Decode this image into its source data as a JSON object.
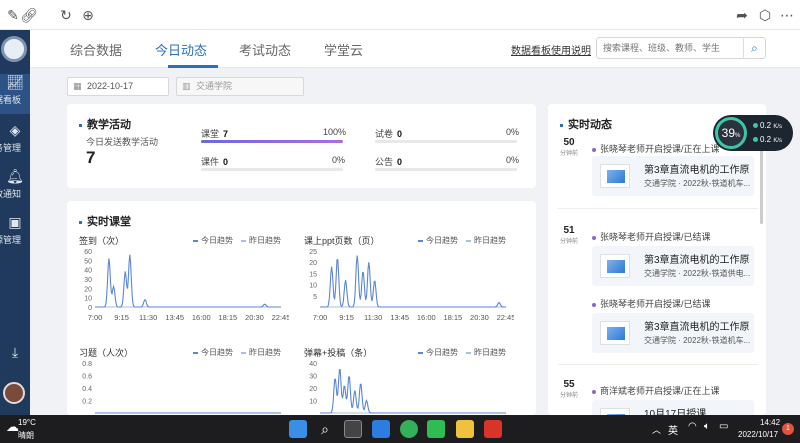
{
  "browser": {
    "icons": [
      "pen-icon",
      "link-icon",
      "refresh-icon",
      "globe-icon",
      "share-icon",
      "cube-icon",
      "more-icon"
    ]
  },
  "sidebar": {
    "items": [
      {
        "label": "据看板",
        "icon": "chart-icon",
        "active": true
      },
      {
        "label": "务管理",
        "icon": "layers-icon",
        "active": false
      },
      {
        "label": "政通知",
        "icon": "bell-icon",
        "active": false
      },
      {
        "label": "源管理",
        "icon": "box-icon",
        "active": false
      }
    ]
  },
  "nav": {
    "tabs": [
      {
        "label": "综合数据",
        "active": false
      },
      {
        "label": "今日动态",
        "active": true
      },
      {
        "label": "考试动态",
        "active": false
      },
      {
        "label": "学堂云",
        "active": false
      }
    ],
    "help_link": "数据看板使用说明",
    "search_placeholder": "搜索课程、班级、教师、学生"
  },
  "filters": {
    "date": "2022-10-17",
    "college": "交通学院"
  },
  "teaching": {
    "title": "教学活动",
    "today_label": "今日发送教学活动",
    "today_count": "7",
    "metrics": [
      {
        "label": "课堂",
        "value": "7",
        "percent": "100%",
        "fill": 1.0
      },
      {
        "label": "课件",
        "value": "0",
        "percent": "0%",
        "fill": 0
      },
      {
        "label": "试卷",
        "value": "0",
        "percent": "0%",
        "fill": 0
      },
      {
        "label": "公告",
        "value": "0",
        "percent": "0%",
        "fill": 0
      }
    ]
  },
  "realtime_class": {
    "title": "实时课堂",
    "legend_today": "今日趋势",
    "legend_yesterday": "昨日趋势"
  },
  "chart_data": [
    {
      "type": "line",
      "title": "签到（次）",
      "x": [
        "7:00",
        "9:15",
        "11:30",
        "13:45",
        "16:00",
        "18:15",
        "20:30",
        "22:45"
      ],
      "ylim": [
        0,
        60
      ],
      "yticks": [
        0,
        10,
        20,
        30,
        40,
        50,
        60
      ],
      "series": [
        {
          "name": "今日趋势",
          "peaks": [
            [
              8.2,
              52
            ],
            [
              8.6,
              22
            ],
            [
              9.6,
              38
            ],
            [
              10.0,
              56
            ],
            [
              11.3,
              8
            ],
            [
              21.6,
              3
            ]
          ]
        },
        {
          "name": "昨日趋势",
          "flat": 0
        }
      ]
    },
    {
      "type": "line",
      "title": "课上ppt页数（页）",
      "x": [
        "7:00",
        "9:15",
        "11:30",
        "13:45",
        "16:00",
        "18:15",
        "20:30",
        "22:45"
      ],
      "ylim": [
        0,
        25
      ],
      "yticks": [
        5,
        10,
        15,
        20,
        25
      ],
      "series": [
        {
          "name": "今日趋势",
          "peaks": [
            [
              8.0,
              18
            ],
            [
              8.5,
              22
            ],
            [
              9.2,
              12
            ],
            [
              10.2,
              23
            ],
            [
              10.7,
              16
            ],
            [
              11.2,
              20
            ],
            [
              11.7,
              12
            ],
            [
              22.4,
              2
            ]
          ]
        },
        {
          "name": "昨日趋势",
          "flat": 0
        }
      ]
    },
    {
      "type": "line",
      "title": "习题（人次）",
      "x": [
        "7:00",
        "9:15",
        "11:30",
        "13:45",
        "16:00",
        "18:15",
        "20:30",
        "22:45"
      ],
      "ylim": [
        0,
        0.8
      ],
      "yticks": [
        0.2,
        0.4,
        0.6,
        0.8
      ],
      "series": [
        {
          "name": "今日趋势",
          "flat": 0
        },
        {
          "name": "昨日趋势",
          "flat": 0
        }
      ]
    },
    {
      "type": "line",
      "title": "弹幕+投稿（条）",
      "x": [
        "7:00",
        "9:15",
        "11:30",
        "13:45",
        "16:00",
        "18:15",
        "20:30",
        "22:45"
      ],
      "ylim": [
        0,
        40
      ],
      "yticks": [
        10,
        20,
        30,
        40
      ],
      "series": [
        {
          "name": "今日趋势",
          "peaks": [
            [
              8.3,
              28
            ],
            [
              8.7,
              36
            ],
            [
              9.1,
              22
            ],
            [
              9.5,
              30
            ],
            [
              10.0,
              18
            ],
            [
              10.5,
              24
            ],
            [
              11.0,
              10
            ]
          ]
        },
        {
          "name": "昨日趋势",
          "flat": 0
        }
      ]
    }
  ],
  "feed": {
    "title": "实时动态",
    "items": [
      {
        "mins": "50",
        "unit": "分钟前",
        "headline": "张晓琴老师开启授课/正在上课",
        "course": "第3章直流电机的工作原...",
        "meta": "交通学院 · 2022秋-铁道机车..."
      },
      {
        "mins": "51",
        "unit": "分钟前",
        "headline": "张晓琴老师开启授课/已结课",
        "course": "第3章直流电机的工作原...",
        "meta": "交通学院 · 2022秋-铁道供电..."
      },
      {
        "mins": "",
        "unit": "",
        "headline": "张晓琴老师开启授课/已结课",
        "course": "第3章直流电机的工作原...",
        "meta": "交通学院 · 2022秋-铁道机车..."
      },
      {
        "mins": "55",
        "unit": "分钟前",
        "headline": "商洋斌老师开启授课/正在上课",
        "course": "10月17日授课",
        "meta": ""
      }
    ]
  },
  "net_widget": {
    "percent": "39",
    "unit": "%",
    "up": "0.2",
    "down": "0.2",
    "rate_unit": "K/s"
  },
  "taskbar": {
    "weather_temp": "19°C",
    "weather_desc": "晴朗",
    "lang": "英",
    "time": "14:42",
    "date": "2022/10/17",
    "notification_count": "1"
  }
}
